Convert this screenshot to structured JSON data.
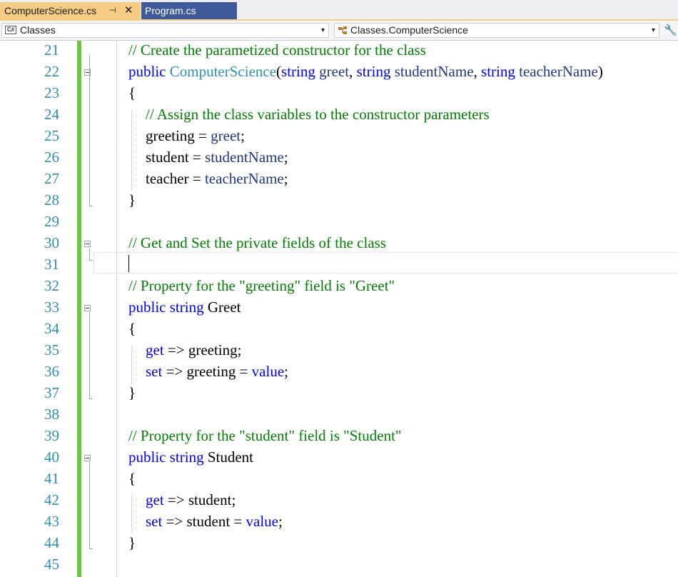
{
  "tabs": [
    {
      "label": "ComputerScience.cs",
      "pin": "⊣",
      "close": "✕"
    },
    {
      "label": "Program.cs"
    }
  ],
  "nav": {
    "project_icon": "C#",
    "project": "Classes",
    "member": "Classes.ComputerScience",
    "dropdown_arrow": "▾",
    "settings_icon": "🔧"
  },
  "colors": {
    "active_tab": "#f5cc84",
    "inactive_tab": "#3f5a99",
    "change_bar": "#6cc644",
    "keyword": "#0000ff",
    "type": "#2b91af",
    "comment": "#008000",
    "parameter": "#1f377f"
  },
  "editor": {
    "current_line": 31,
    "lines": [
      {
        "n": "21",
        "t": [
          [
            "cm",
            "// Create the parametized constructor for the class"
          ]
        ]
      },
      {
        "n": "22",
        "t": [
          [
            "kw",
            "public "
          ],
          [
            "type",
            "ComputerScience"
          ],
          [
            "",
            "("
          ],
          [
            "kw",
            "string "
          ],
          [
            "var",
            "greet"
          ],
          [
            "",
            ", "
          ],
          [
            "kw",
            "string "
          ],
          [
            "var",
            "studentName"
          ],
          [
            "",
            ", "
          ],
          [
            "kw",
            "string "
          ],
          [
            "var",
            "teacherName"
          ],
          [
            "",
            ")"
          ]
        ]
      },
      {
        "n": "23",
        "t": [
          [
            "",
            "{"
          ]
        ]
      },
      {
        "n": "24",
        "t": [
          [
            "cm",
            "// Assign the class variables to the constructor parameters"
          ]
        ]
      },
      {
        "n": "25",
        "t": [
          [
            "",
            "greeting = "
          ],
          [
            "var",
            "greet"
          ],
          [
            "",
            ";"
          ]
        ]
      },
      {
        "n": "26",
        "t": [
          [
            "",
            "student = "
          ],
          [
            "var",
            "studentName"
          ],
          [
            "",
            ";"
          ]
        ]
      },
      {
        "n": "27",
        "t": [
          [
            "",
            "teacher = "
          ],
          [
            "var",
            "teacherName"
          ],
          [
            "",
            ";"
          ]
        ]
      },
      {
        "n": "28",
        "t": [
          [
            "",
            "}"
          ]
        ]
      },
      {
        "n": "29",
        "t": []
      },
      {
        "n": "30",
        "t": [
          [
            "cm",
            "// Get and Set the private fields of the class"
          ]
        ]
      },
      {
        "n": "31",
        "t": []
      },
      {
        "n": "32",
        "t": [
          [
            "cm",
            "// Property for the \"greeting\" field is \"Greet\""
          ]
        ]
      },
      {
        "n": "33",
        "t": [
          [
            "kw",
            "public "
          ],
          [
            "kw",
            "string "
          ],
          [
            "",
            "Greet"
          ]
        ]
      },
      {
        "n": "34",
        "t": [
          [
            "",
            "{"
          ]
        ]
      },
      {
        "n": "35",
        "t": [
          [
            "kw",
            "get"
          ],
          [
            "",
            " => greeting;"
          ]
        ]
      },
      {
        "n": "36",
        "t": [
          [
            "kw",
            "set"
          ],
          [
            "",
            " => greeting = "
          ],
          [
            "kw",
            "value"
          ],
          [
            "",
            ";"
          ]
        ]
      },
      {
        "n": "37",
        "t": [
          [
            "",
            "}"
          ]
        ]
      },
      {
        "n": "38",
        "t": []
      },
      {
        "n": "39",
        "t": [
          [
            "cm",
            "// Property for the \"student\" field is \"Student\""
          ]
        ]
      },
      {
        "n": "40",
        "t": [
          [
            "kw",
            "public "
          ],
          [
            "kw",
            "string "
          ],
          [
            "",
            "Student"
          ]
        ]
      },
      {
        "n": "41",
        "t": [
          [
            "",
            "{"
          ]
        ]
      },
      {
        "n": "42",
        "t": [
          [
            "kw",
            "get"
          ],
          [
            "",
            " => student;"
          ]
        ]
      },
      {
        "n": "43",
        "t": [
          [
            "kw",
            "set"
          ],
          [
            "",
            " => student = "
          ],
          [
            "kw",
            "value"
          ],
          [
            "",
            ";"
          ]
        ]
      },
      {
        "n": "44",
        "t": [
          [
            "",
            "}"
          ]
        ]
      },
      {
        "n": "45",
        "t": []
      }
    ]
  }
}
